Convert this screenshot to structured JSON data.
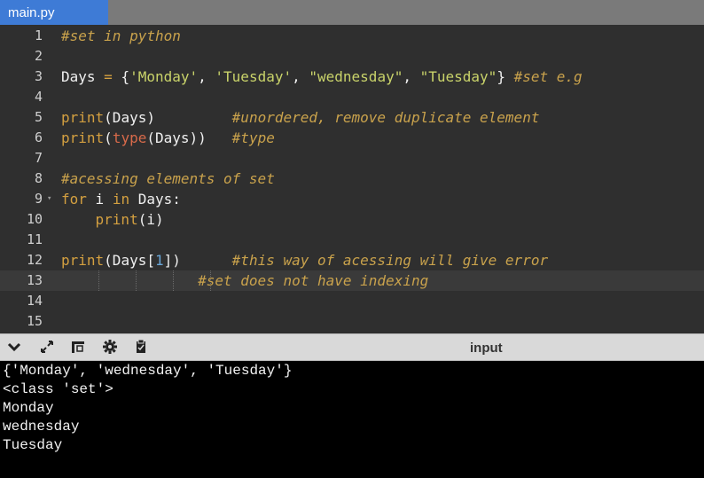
{
  "tab": {
    "filename": "main.py"
  },
  "editor": {
    "lines": [
      {
        "no": "1",
        "tokens": [
          {
            "t": "#set in python",
            "c": "cm"
          }
        ]
      },
      {
        "no": "2",
        "tokens": []
      },
      {
        "no": "3",
        "tokens": [
          {
            "t": "Days ",
            "c": ""
          },
          {
            "t": "=",
            "c": "op"
          },
          {
            "t": " {",
            "c": ""
          },
          {
            "t": "'Monday'",
            "c": "str"
          },
          {
            "t": ", ",
            "c": ""
          },
          {
            "t": "'Tuesday'",
            "c": "str"
          },
          {
            "t": ", ",
            "c": ""
          },
          {
            "t": "\"wednesday\"",
            "c": "str"
          },
          {
            "t": ", ",
            "c": ""
          },
          {
            "t": "\"Tuesday\"",
            "c": "str"
          },
          {
            "t": "} ",
            "c": ""
          },
          {
            "t": "#set e.g",
            "c": "cm"
          }
        ]
      },
      {
        "no": "4",
        "tokens": []
      },
      {
        "no": "5",
        "tokens": [
          {
            "t": "print",
            "c": "kw"
          },
          {
            "t": "(Days)         ",
            "c": ""
          },
          {
            "t": "#unordered, remove duplicate element",
            "c": "cm"
          }
        ]
      },
      {
        "no": "6",
        "tokens": [
          {
            "t": "print",
            "c": "kw"
          },
          {
            "t": "(",
            "c": ""
          },
          {
            "t": "type",
            "c": "bi"
          },
          {
            "t": "(Days))   ",
            "c": ""
          },
          {
            "t": "#type",
            "c": "cm"
          }
        ]
      },
      {
        "no": "7",
        "tokens": []
      },
      {
        "no": "8",
        "tokens": [
          {
            "t": "#acessing elements of set",
            "c": "cm"
          }
        ]
      },
      {
        "no": "9",
        "fold": true,
        "tokens": [
          {
            "t": "for",
            "c": "kw"
          },
          {
            "t": " i ",
            "c": ""
          },
          {
            "t": "in",
            "c": "kw"
          },
          {
            "t": " Days:",
            "c": ""
          }
        ]
      },
      {
        "no": "10",
        "tokens": [
          {
            "t": "    ",
            "c": ""
          },
          {
            "t": "print",
            "c": "kw"
          },
          {
            "t": "(i)",
            "c": ""
          }
        ]
      },
      {
        "no": "11",
        "tokens": []
      },
      {
        "no": "12",
        "tokens": [
          {
            "t": "print",
            "c": "kw"
          },
          {
            "t": "(Days[",
            "c": ""
          },
          {
            "t": "1",
            "c": "num"
          },
          {
            "t": "])      ",
            "c": ""
          },
          {
            "t": "#this way of acessing will give error",
            "c": "cm"
          }
        ]
      },
      {
        "no": "13",
        "active": true,
        "tokens": [
          {
            "t": "                ",
            "c": ""
          },
          {
            "t": "#set does not have indexing",
            "c": "cm"
          }
        ]
      },
      {
        "no": "14",
        "tokens": []
      },
      {
        "no": "15",
        "tokens": []
      }
    ]
  },
  "console": {
    "title": "input",
    "toolbar_icons": [
      "chevron-down-icon",
      "expand-icon",
      "layout-icon",
      "gear-icon",
      "clipboard-icon"
    ],
    "output": [
      "{'Monday', 'wednesday', 'Tuesday'}",
      "<class 'set'>",
      "Monday",
      "wednesday",
      "Tuesday"
    ]
  }
}
